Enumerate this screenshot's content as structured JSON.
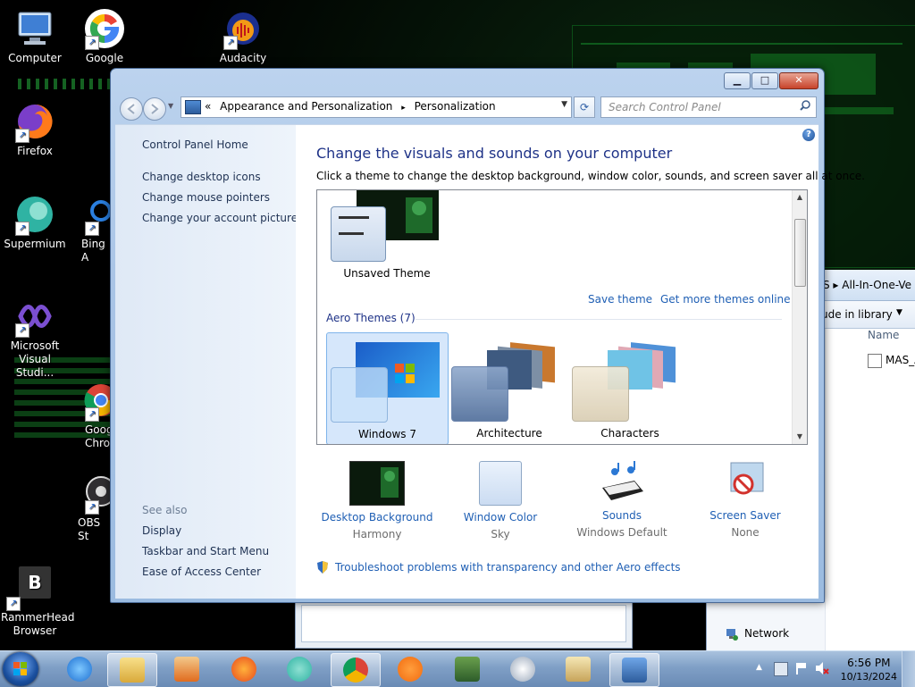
{
  "desktop": {
    "icons": [
      {
        "label": "Computer"
      },
      {
        "label": "Google"
      },
      {
        "label": "Audacity"
      },
      {
        "label": "Firefox"
      },
      {
        "label": "Supermium"
      },
      {
        "label": "Bing A"
      },
      {
        "label": "Microsoft Visual Studi..."
      },
      {
        "label": "Goog Chro"
      },
      {
        "label": "OBS St"
      },
      {
        "label": "RammerHead Browser"
      }
    ],
    "rammerhead_letter": "B"
  },
  "background_window": {
    "breadcrumb_tail": "S  ▸  All-In-One-Ve",
    "toolbar_item": "ude in library",
    "column_name": "Name",
    "file_name": "MAS_A",
    "network_label": "Network"
  },
  "window": {
    "caption": {
      "minimize": "▁",
      "maximize": "□",
      "close": "✕"
    },
    "address": {
      "root_chevron": "«",
      "crumb1": "Appearance and Personalization",
      "sep": "▸",
      "crumb2": "Personalization"
    },
    "search": {
      "placeholder": "Search Control Panel"
    },
    "sidebar": {
      "home": "Control Panel Home",
      "links": [
        "Change desktop icons",
        "Change mouse pointers",
        "Change your account picture"
      ],
      "see_also": "See also",
      "see_also_links": [
        "Display",
        "Taskbar and Start Menu",
        "Ease of Access Center"
      ]
    },
    "main": {
      "title": "Change the visuals and sounds on your computer",
      "subtitle": "Click a theme to change the desktop background, window color, sounds, and screen saver all at once.",
      "unsaved_theme": "Unsaved Theme",
      "save_theme": "Save theme",
      "get_more": "Get more themes online",
      "aero_heading": "Aero Themes (7)",
      "themes": [
        {
          "label": "Windows 7",
          "selected": true
        },
        {
          "label": "Architecture",
          "selected": false
        },
        {
          "label": "Characters",
          "selected": false
        }
      ],
      "bottom": [
        {
          "title": "Desktop Background",
          "value": "Harmony"
        },
        {
          "title": "Window Color",
          "value": "Sky"
        },
        {
          "title": "Sounds",
          "value": "Windows Default"
        },
        {
          "title": "Screen Saver",
          "value": "None"
        }
      ],
      "troubleshoot": "Troubleshoot problems with transparency and other Aero effects"
    }
  },
  "taskbar": {
    "clock_time": "6:56 PM",
    "clock_date": "10/13/2024"
  },
  "colors": {
    "link": "#1f5fb4",
    "title": "#1e3287"
  }
}
